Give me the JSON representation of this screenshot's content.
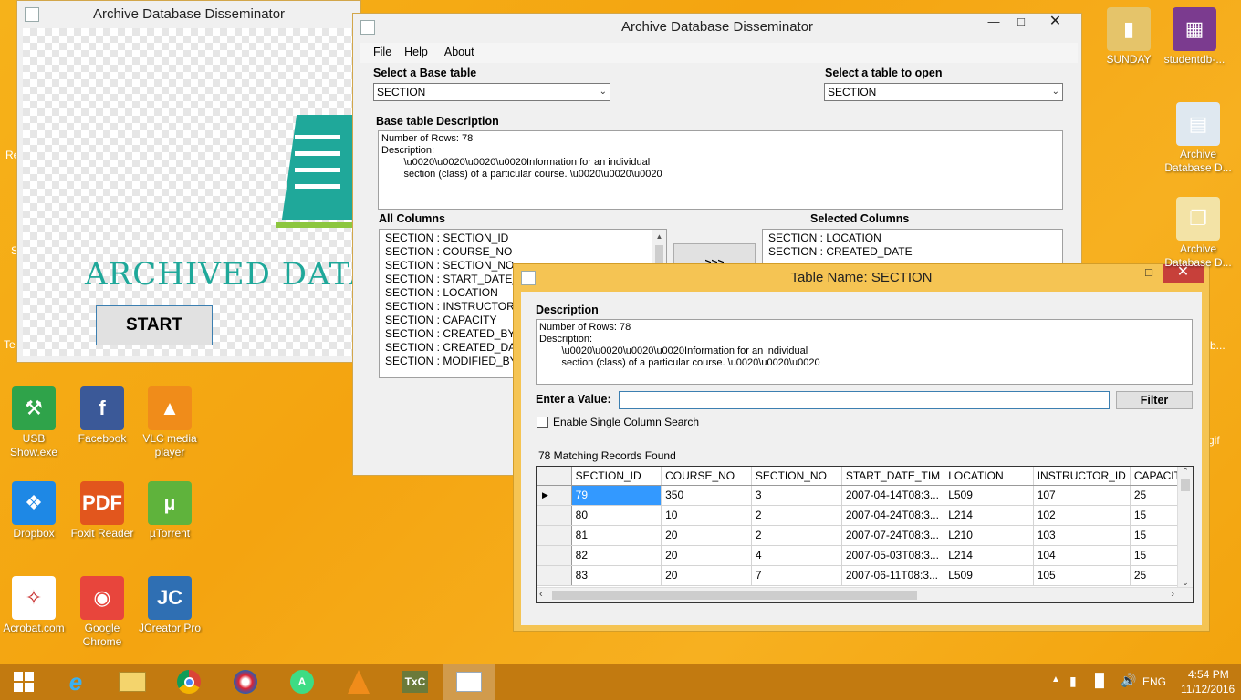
{
  "desktop": {
    "icons": [
      {
        "label": "USB Show.exe",
        "color": "#2fa34a",
        "glyph": "⚒",
        "icon": "usb-show-icon"
      },
      {
        "label": "Facebook",
        "color": "#3b5998",
        "glyph": "f",
        "icon": "facebook-icon"
      },
      {
        "label": "VLC media player",
        "color": "#f08c1a",
        "glyph": "▲",
        "icon": "vlc-icon"
      },
      {
        "label": "Dropbox",
        "color": "#1e88e5",
        "glyph": "❖",
        "icon": "dropbox-icon"
      },
      {
        "label": "Foxit Reader",
        "color": "#e2561d",
        "glyph": "PDF",
        "icon": "foxit-icon"
      },
      {
        "label": "µTorrent",
        "color": "#5fb33c",
        "glyph": "µ",
        "icon": "utorrent-icon"
      },
      {
        "label": "Acrobat.com",
        "color": "#ffffff",
        "glyph": "✧",
        "icon": "acrobat-icon"
      },
      {
        "label": "Google Chrome",
        "color": "#e8453c",
        "glyph": "◉",
        "icon": "chrome-icon"
      },
      {
        "label": "JCreator Pro",
        "color": "#2f6fb3",
        "glyph": "JC",
        "icon": "jcreator-icon"
      },
      {
        "label": "SUNDAY",
        "color": "#e5c46a",
        "glyph": "▮",
        "icon": "folder-icon"
      },
      {
        "label": "studentdb-...",
        "color": "#7b3b8f",
        "glyph": "▦",
        "icon": "winrar-icon"
      },
      {
        "label": "Archive Database D...",
        "color": "#dfe8f0",
        "glyph": "▤",
        "icon": "archive-app-icon"
      },
      {
        "label": "Archive Database D...",
        "color": "#f3e3a6",
        "glyph": "❐",
        "icon": "archive-vs-icon"
      }
    ],
    "edge_fragments": {
      "re": "Re",
      "s": "S",
      "te": "Te",
      "b": "b...",
      "gif": "gif"
    }
  },
  "splash": {
    "title": "Archive Database Disseminator",
    "logo_text": "ARCHIVED DATAB",
    "start_label": "START"
  },
  "main_window": {
    "title": "Archive Database Disseminator",
    "menu": [
      "File",
      "Help",
      "About"
    ],
    "base_table_label": "Select a Base table",
    "base_table_value": "SECTION",
    "open_table_label": "Select a table to open",
    "open_table_value": "SECTION",
    "description_label": "Base table Description",
    "description_text": "Number of Rows: 78\nDescription:\n        \\u0020\\u0020\\u0020\\u0020Information for an individual\n        section (class) of a particular course. \\u0020\\u0020\\u0020",
    "all_columns_label": "All Columns",
    "all_columns": [
      "SECTION : SECTION_ID",
      "SECTION : COURSE_NO",
      "SECTION : SECTION_NO",
      "SECTION : START_DATE_T",
      "SECTION : LOCATION",
      "SECTION : INSTRUCTOR_ID",
      "SECTION : CAPACITY",
      "SECTION : CREATED_BY",
      "SECTION : CREATED_DATE",
      "SECTION : MODIFIED_BY"
    ],
    "selected_columns_label": "Selected Columns",
    "selected_columns": [
      "SECTION : LOCATION",
      "SECTION : CREATED_DATE"
    ],
    "move_button": ">>>"
  },
  "table_window": {
    "title": "Table Name: SECTION",
    "description_label": "Description",
    "description_text": "Number of Rows: 78\nDescription:\n        \\u0020\\u0020\\u0020\\u0020Information for an individual\n        section (class) of a particular course. \\u0020\\u0020\\u0020",
    "enter_value_label": "Enter a Value:",
    "filter_button": "Filter",
    "single_column_label": "Enable Single Column Search",
    "records_found": "78 Matching Records Found",
    "columns": [
      "SECTION_ID",
      "COURSE_NO",
      "SECTION_NO",
      "START_DATE_TIM",
      "LOCATION",
      "INSTRUCTOR_ID",
      "CAPACITY"
    ],
    "rows": [
      [
        "79",
        "350",
        "3",
        "2007-04-14T08:3...",
        "L509",
        "107",
        "25"
      ],
      [
        "80",
        "10",
        "2",
        "2007-04-24T08:3...",
        "L214",
        "102",
        "15"
      ],
      [
        "81",
        "20",
        "2",
        "2007-07-24T08:3...",
        "L210",
        "103",
        "15"
      ],
      [
        "82",
        "20",
        "4",
        "2007-05-03T08:3...",
        "L214",
        "104",
        "15"
      ],
      [
        "83",
        "20",
        "7",
        "2007-06-11T08:3...",
        "L509",
        "105",
        "25"
      ]
    ]
  },
  "taskbar": {
    "language": "ENG",
    "time": "4:54 PM",
    "date": "11/12/2016"
  }
}
